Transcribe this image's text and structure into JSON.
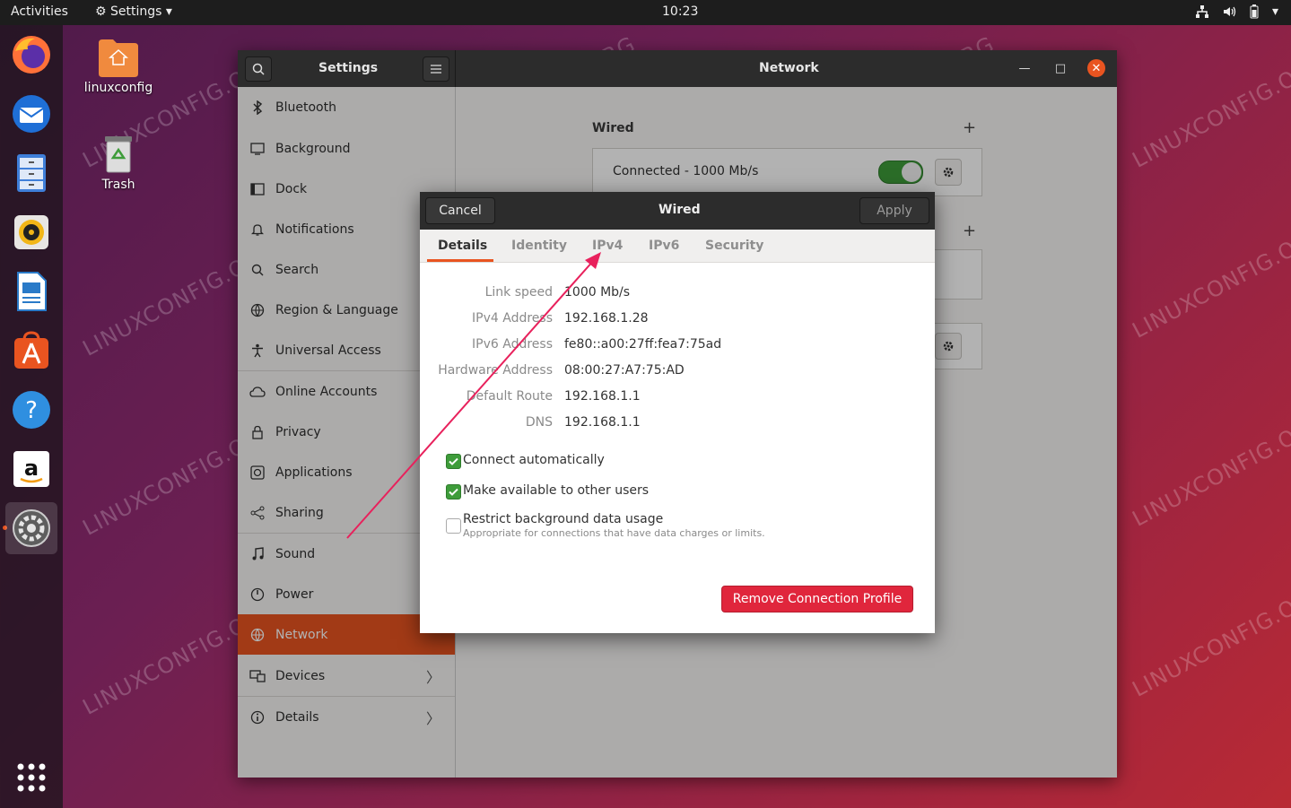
{
  "topbar": {
    "activities": "Activities",
    "app_menu": "Settings",
    "clock": "10:23"
  },
  "desktop": {
    "home_label": "linuxconfig",
    "trash_label": "Trash",
    "watermark": "LINUXCONFIG.ORG"
  },
  "window": {
    "sidebar_title": "Settings",
    "panel_title": "Network"
  },
  "sidebar": {
    "items": [
      {
        "label": "Bluetooth",
        "icon": "bluetooth-icon"
      },
      {
        "label": "Background",
        "icon": "background-icon"
      },
      {
        "label": "Dock",
        "icon": "dock-icon"
      },
      {
        "label": "Notifications",
        "icon": "bell-icon"
      },
      {
        "label": "Search",
        "icon": "search-icon"
      },
      {
        "label": "Region & Language",
        "icon": "globe-icon"
      },
      {
        "label": "Universal Access",
        "icon": "accessibility-icon"
      },
      {
        "label": "Online Accounts",
        "icon": "cloud-icon"
      },
      {
        "label": "Privacy",
        "icon": "lock-icon"
      },
      {
        "label": "Applications",
        "icon": "applications-icon"
      },
      {
        "label": "Sharing",
        "icon": "share-icon"
      },
      {
        "label": "Sound",
        "icon": "music-note-icon"
      },
      {
        "label": "Power",
        "icon": "power-icon"
      },
      {
        "label": "Network",
        "icon": "network-icon"
      },
      {
        "label": "Devices",
        "icon": "devices-icon"
      },
      {
        "label": "Details",
        "icon": "info-icon"
      }
    ]
  },
  "network": {
    "wired_title": "Wired",
    "connection_status": "Connected - 1000 Mb/s"
  },
  "dialog": {
    "cancel": "Cancel",
    "title": "Wired",
    "apply": "Apply",
    "tabs": [
      "Details",
      "Identity",
      "IPv4",
      "IPv6",
      "Security"
    ],
    "details": [
      {
        "key": "Link speed",
        "value": "1000 Mb/s"
      },
      {
        "key": "IPv4 Address",
        "value": "192.168.1.28"
      },
      {
        "key": "IPv6 Address",
        "value": "fe80::a00:27ff:fea7:75ad"
      },
      {
        "key": "Hardware Address",
        "value": "08:00:27:A7:75:AD"
      },
      {
        "key": "Default Route",
        "value": "192.168.1.1"
      },
      {
        "key": "DNS",
        "value": "192.168.1.1"
      }
    ],
    "options": {
      "connect_auto": "Connect automatically",
      "available_all": "Make available to other users",
      "restrict_bg": "Restrict background data usage",
      "restrict_bg_sub": "Appropriate for connections that have data charges or limits."
    },
    "remove_profile": "Remove Connection Profile"
  },
  "colors": {
    "accent": "#e95420",
    "toggle_on": "#3e9c3a",
    "danger": "#e0263c"
  }
}
